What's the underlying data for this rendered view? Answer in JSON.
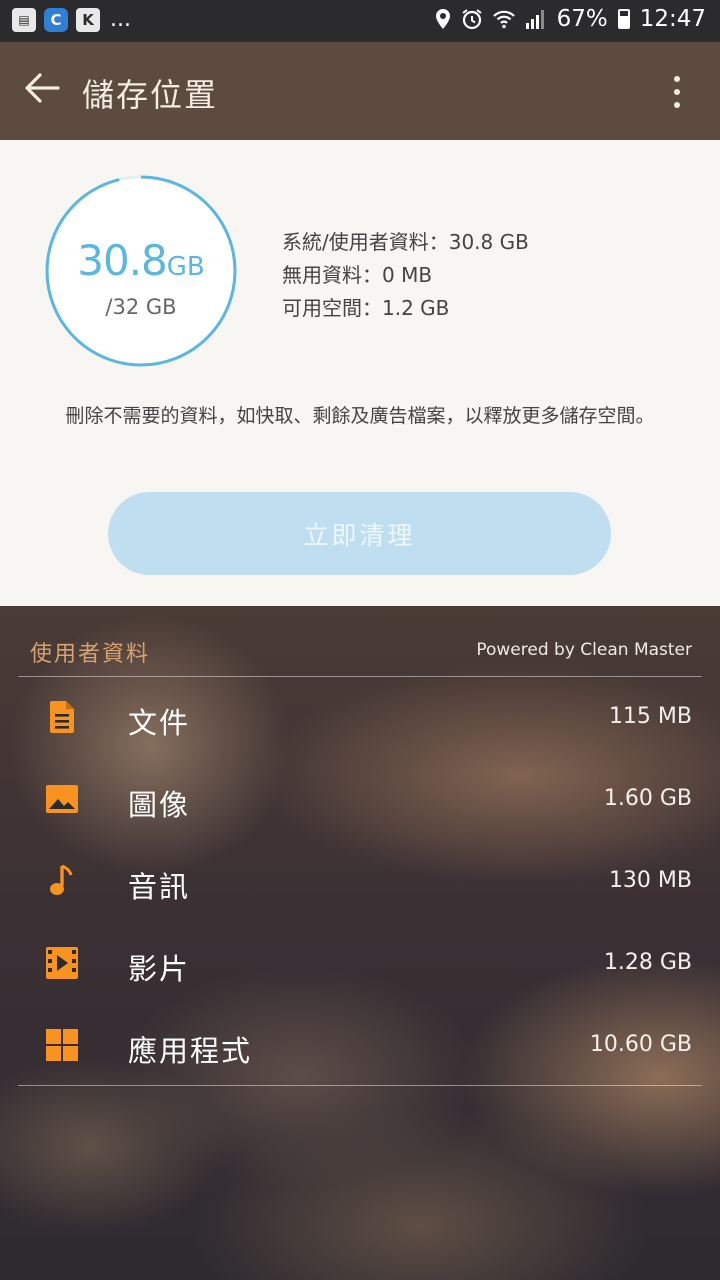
{
  "status_bar": {
    "battery": "67%",
    "time": "12:47",
    "overflow": "...",
    "battery_level": 0.67
  },
  "app_bar": {
    "title": "儲存位置"
  },
  "storage": {
    "used_value": "30.8",
    "used_unit": "GB",
    "total": "/32 GB",
    "used_fraction": 0.9625,
    "stats": [
      "系統/使用者資料：30.8 GB",
      "無用資料：0 MB",
      "可用空間：1.2 GB"
    ],
    "description": "刪除不需要的資料，如快取、剩餘及廣告檔案，以釋放更多儲存空間。",
    "clean_button": "立即清理"
  },
  "user_data": {
    "heading": "使用者資料",
    "powered_by": "Powered by Clean Master",
    "items": [
      {
        "label": "文件",
        "size": "115 MB",
        "icon": "document-icon"
      },
      {
        "label": "圖像",
        "size": "1.60 GB",
        "icon": "image-icon"
      },
      {
        "label": "音訊",
        "size": "130 MB",
        "icon": "music-note-icon"
      },
      {
        "label": "影片",
        "size": "1.28 GB",
        "icon": "video-icon"
      },
      {
        "label": "應用程式",
        "size": "10.60 GB",
        "icon": "apps-grid-icon"
      }
    ]
  },
  "colors": {
    "accent_icon": "#f7931e",
    "ring": "#5ab7e0",
    "app_bar": "#5c4b3e",
    "section_heading": "#d8a36e",
    "button": "#bfdff0"
  }
}
